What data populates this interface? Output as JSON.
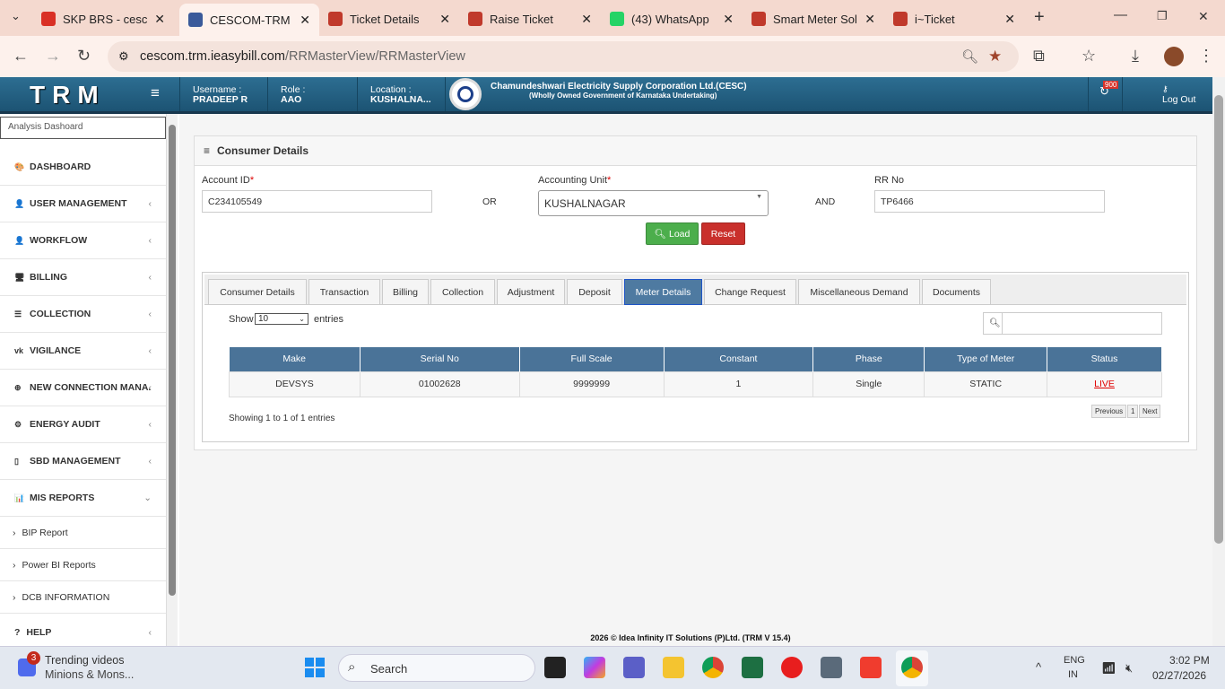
{
  "browser": {
    "tabs": [
      {
        "label": "SKP BRS - cesco",
        "color": "#d93025"
      },
      {
        "label": "CESCOM-TRM",
        "color": "#3a5a9a",
        "active": true
      },
      {
        "label": "Ticket Details",
        "color": "#c0392b"
      },
      {
        "label": "Raise Ticket",
        "color": "#c0392b"
      },
      {
        "label": "(43) WhatsApp",
        "color": "#25d366"
      },
      {
        "label": "Smart Meter Sol",
        "color": "#c0392b"
      },
      {
        "label": "i~Ticket",
        "color": "#c0392b"
      }
    ],
    "close_glyph": "✕",
    "new_tab_glyph": "+",
    "url_host": "cescom.trm.ieasybill.com",
    "url_path": "/RRMasterView/RRMasterView"
  },
  "header": {
    "logo": "TRM",
    "menu_glyph": "≡",
    "username_label": "Username :",
    "username": "PRADEEP R",
    "role_label": "Role :",
    "role": "AAO",
    "location_label": "Location :",
    "location": "KUSHALNA...",
    "org_name": "Chamundeshwari Electricity Supply Corporation Ltd.(CESC)",
    "org_sub": "(Wholly Owned Government of Karnataka Undertaking)",
    "notif_count": "900",
    "logout": "Log Out"
  },
  "sidebar": {
    "search_value": "Analysis Dashoard",
    "items": [
      {
        "label": "DASHBOARD",
        "icon": "🎨",
        "chev": ""
      },
      {
        "label": "USER MANAGEMENT",
        "icon": "👤",
        "chev": "‹"
      },
      {
        "label": "WORKFLOW",
        "icon": "👤",
        "chev": "‹"
      },
      {
        "label": "BILLING",
        "icon": "🖥",
        "chev": "‹"
      },
      {
        "label": "COLLECTION",
        "icon": "☰",
        "chev": "‹"
      },
      {
        "label": "VIGILANCE",
        "icon": "vk",
        "chev": "‹"
      },
      {
        "label": "NEW CONNECTION MANA.",
        "icon": "⊕",
        "chev": "‹"
      },
      {
        "label": "ENERGY AUDIT",
        "icon": "⚙",
        "chev": "‹"
      },
      {
        "label": "SBD MANAGEMENT",
        "icon": "▯",
        "chev": "‹"
      },
      {
        "label": "MIS REPORTS",
        "icon": "📊",
        "chev": "⌄"
      }
    ],
    "subitems": [
      "BIP Report",
      "Power BI Reports",
      "DCB INFORMATION"
    ],
    "help": "HELP"
  },
  "consumer": {
    "title": "Consumer Details",
    "account_label": "Account ID",
    "account_value": "C234105549",
    "or": "OR",
    "unit_label": "Accounting Unit",
    "unit_value": "KUSHALNAGAR",
    "and": "AND",
    "rr_label": "RR No",
    "rr_value": "TP6466",
    "req": "*",
    "load": "Load",
    "reset": "Reset"
  },
  "tabs": [
    "Consumer Details",
    "Transaction",
    "Billing",
    "Collection",
    "Adjustment",
    "Deposit",
    "Meter Details",
    "Change Request",
    "Miscellaneous Demand",
    "Documents"
  ],
  "table": {
    "show": "Show",
    "entries_value": "10",
    "entries": "entries",
    "columns": [
      "Make",
      "Serial No",
      "Full Scale",
      "Constant",
      "Phase",
      "Type of Meter",
      "Status"
    ],
    "rows": [
      [
        "DEVSYS",
        "01002628",
        "9999999",
        "1",
        "Single",
        "STATIC",
        "LIVE"
      ]
    ],
    "info": "Showing 1 to 1 of 1 entries",
    "prev": "Previous",
    "page": "1",
    "next": "Next"
  },
  "footer": "2026 © Idea Infinity IT Solutions (P)Ltd. (TRM V 15.4)",
  "taskbar": {
    "widget_badge": "3",
    "widget_title": "Trending videos",
    "widget_sub": "Minions & Mons...",
    "search": "Search",
    "lang1": "ENG",
    "lang2": "IN",
    "time": "3:02 PM",
    "date": "02/27/2026"
  },
  "colors": {
    "accent": "#4a7398",
    "load": "#4cae4c",
    "reset": "#c9302c",
    "live": "#e00000"
  }
}
